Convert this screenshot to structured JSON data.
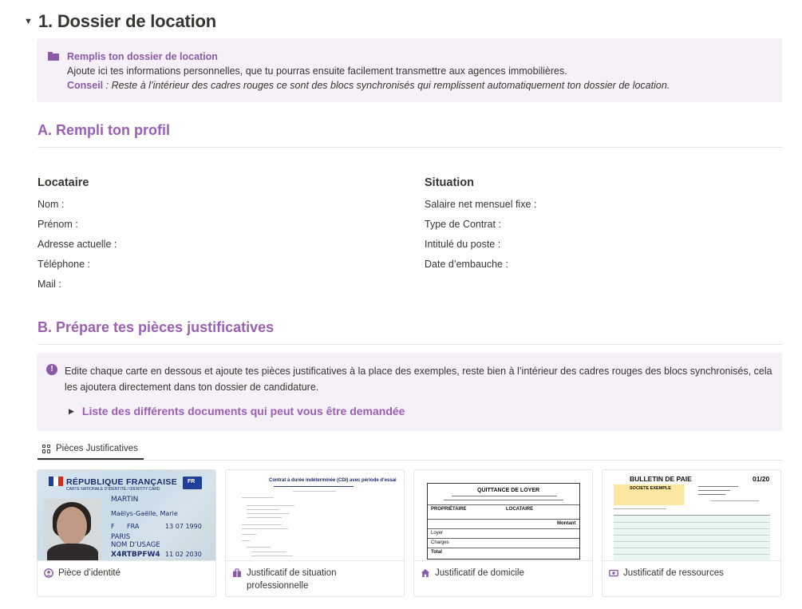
{
  "heading": {
    "title": "1. Dossier de location"
  },
  "callout_intro": {
    "title": "Remplis ton dossier de location",
    "line1": "Ajoute ici tes informations personnelles, que tu pourras ensuite facilement transmettre aux agences immobilières.",
    "tip_label": "Conseil",
    "tip_text": " : Reste à l’intérieur des cadres rouges ce sont des blocs synchronisés qui remplissent automatiquement ton dossier de location."
  },
  "section_a": {
    "title": "A. Rempli ton profil"
  },
  "locataire": {
    "title": "Locataire",
    "fields": [
      "Nom :",
      "Prénom :",
      "Adresse actuelle :",
      "Téléphone :",
      "Mail :"
    ]
  },
  "situation": {
    "title": "Situation",
    "fields": [
      "Salaire net mensuel fixe :",
      "Type de Contrat :",
      "Intitulé du poste :",
      "Date d’embauche :"
    ]
  },
  "section_b": {
    "title": "B. Prépare tes pièces justificatives"
  },
  "callout_docs": {
    "text": "Edite chaque carte en dessous et ajoute tes pièces justificatives à la place des exemples, reste bien à l’intérieur des cadres rouges des blocs synchronisés, cela les ajoutera directement dans ton dossier de candidature.",
    "toggle_label": "Liste des différents documents qui peut vous être demandée"
  },
  "gallery": {
    "tab_label": "Pièces Justificatives",
    "cards": [
      {
        "title": "Pièce d’identité",
        "icon": "user-circle-icon"
      },
      {
        "title": "Justificatif de situation professionnelle",
        "icon": "briefcase-icon"
      },
      {
        "title": "Justificatif de domicile",
        "icon": "home-icon"
      },
      {
        "title": "Justificatif de ressources",
        "icon": "money-icon"
      }
    ]
  },
  "thumbs": {
    "id_card": {
      "country": "RÉPUBLIQUE FRANÇAISE",
      "subtitle": "CARTE NATIONALE D’IDENTITÉ / IDENTITY CARD",
      "surname": "MARTIN",
      "given_names": "Maëlys-Gaëlle, Marie",
      "sex": "F",
      "nationality": "FRA",
      "birth_date": "13 07 1990",
      "birth_place": "PARIS",
      "usage_name": "NOM D’USAGE",
      "doc_number": "X4RTBPFW4",
      "expiry": "11 02 2030",
      "flag_colors": [
        "#1f3f99",
        "#ffffff",
        "#d52b1e"
      ]
    },
    "contract": {
      "title": "Contrat à durée indéterminée (CDI) avec période d’essai"
    },
    "quittance": {
      "title": "QUITTANCE DE LOYER",
      "owner": "PROPRIÉTAIRE",
      "tenant": "LOCATAIRE",
      "amount_label": "Montant",
      "rent": "Loyer",
      "charges": "Charges",
      "total": "Total"
    },
    "bulletin": {
      "title": "BULLETIN DE PAIE",
      "period": "01/20",
      "company": "SOCIETE EXEMPLE"
    }
  },
  "colors": {
    "accent": "#9b5fb4",
    "callout_bg": "#f6f0f8",
    "text": "#37352f"
  }
}
